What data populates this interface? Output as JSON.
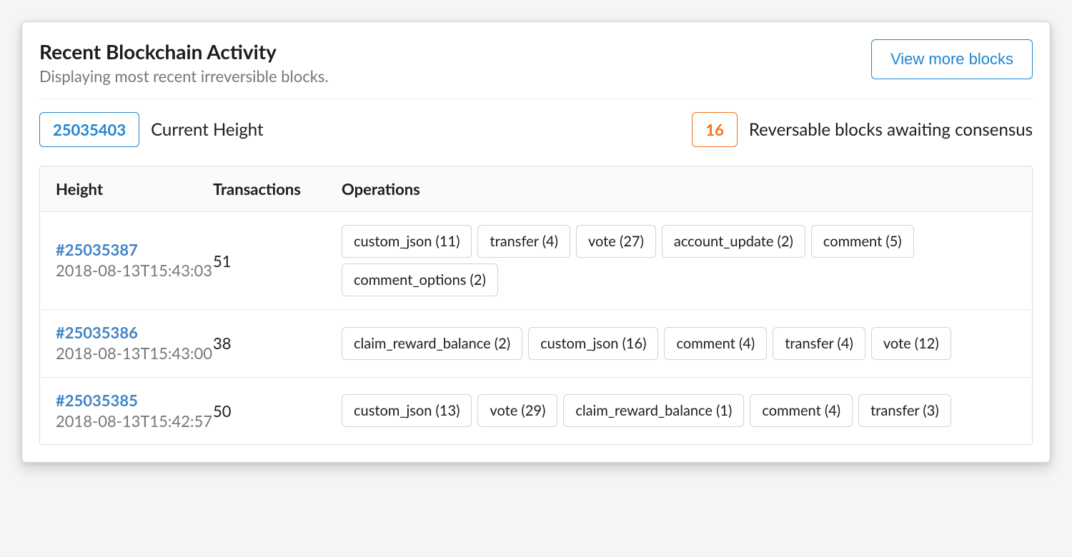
{
  "header": {
    "title": "Recent Blockchain Activity",
    "subtitle": "Displaying most recent irreversible blocks.",
    "view_more_label": "View more blocks"
  },
  "status": {
    "current_height_value": "25035403",
    "current_height_label": "Current Height",
    "reversible_count": "16",
    "reversible_label": "Reversable blocks awaiting consensus"
  },
  "columns": {
    "height": "Height",
    "transactions": "Transactions",
    "operations": "Operations"
  },
  "rows": [
    {
      "block": "#25035387",
      "timestamp": "2018-08-13T15:43:03",
      "tx_count": "51",
      "ops": [
        "custom_json (11)",
        "transfer (4)",
        "vote (27)",
        "account_update (2)",
        "comment (5)",
        "comment_options (2)"
      ]
    },
    {
      "block": "#25035386",
      "timestamp": "2018-08-13T15:43:00",
      "tx_count": "38",
      "ops": [
        "claim_reward_balance (2)",
        "custom_json (16)",
        "comment (4)",
        "transfer (4)",
        "vote (12)"
      ]
    },
    {
      "block": "#25035385",
      "timestamp": "2018-08-13T15:42:57",
      "tx_count": "50",
      "ops": [
        "custom_json (13)",
        "vote (29)",
        "claim_reward_balance (1)",
        "comment (4)",
        "transfer (3)"
      ]
    }
  ]
}
